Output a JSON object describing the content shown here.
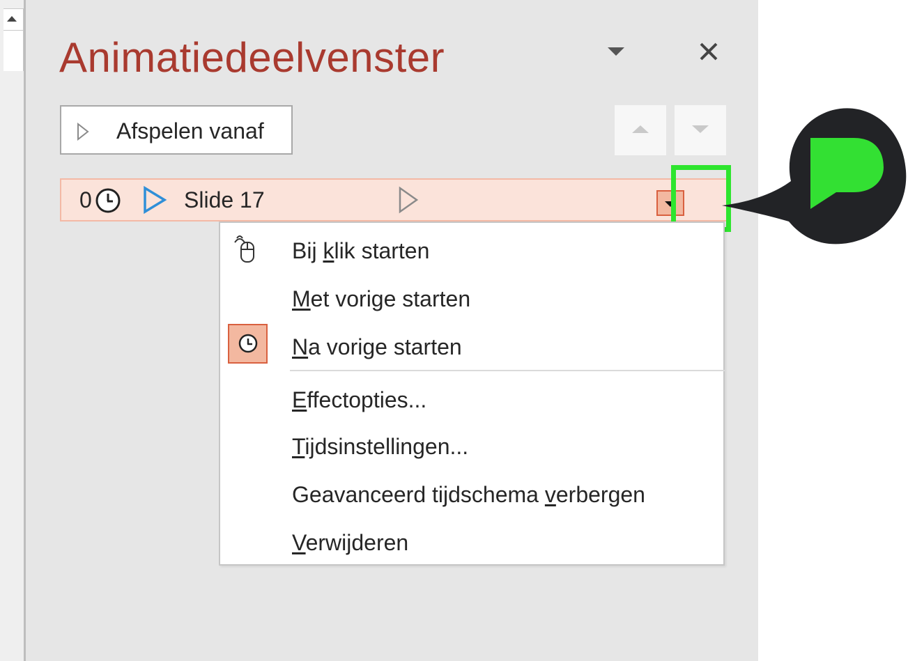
{
  "pane": {
    "title": "Animatiedeelvenster",
    "menu_icon": "dropdown-triangle-icon",
    "close_icon": "close-icon"
  },
  "toolbar": {
    "play_label": "Afspelen vanaf",
    "play_icon": "play-triangle-icon",
    "move_up_icon": "move-up-icon",
    "move_down_icon": "move-down-icon"
  },
  "animation_item": {
    "order": "0",
    "trigger_icon": "clock-icon",
    "effect_icon": "blue-play-icon",
    "name": "Slide 17",
    "timeline_icon": "outline-play-icon",
    "dropdown_icon": "dropdown-arrow-icon"
  },
  "context_menu": {
    "items": [
      {
        "pre": "Bij ",
        "key": "k",
        "post": "lik starten",
        "icon": "mouse-click-icon",
        "checked": false
      },
      {
        "pre": "",
        "key": "M",
        "post": "et vorige starten",
        "icon": "",
        "checked": false
      },
      {
        "pre": "",
        "key": "N",
        "post": "a vorige starten",
        "icon": "clock-icon",
        "checked": true
      },
      {
        "pre": "",
        "key": "E",
        "post": "ffectopties...",
        "icon": "",
        "checked": false
      },
      {
        "pre": "",
        "key": "T",
        "post": "ijdsinstellingen...",
        "icon": "",
        "checked": false
      },
      {
        "pre": "Geavanceerd tijdschema ",
        "key": "v",
        "post": "erbergen",
        "icon": "",
        "checked": false
      },
      {
        "pre": "",
        "key": "V",
        "post": "erwijderen",
        "icon": "",
        "checked": false
      }
    ]
  },
  "colors": {
    "title": "#a93a2f",
    "highlight": "#2ee52e",
    "callout_bubble": "#222326",
    "callout_logo": "#33e033",
    "selected_row": "#fbe3da",
    "accent_blue": "#2f8fd8"
  },
  "callout": {
    "icon": "brand-logo-icon"
  }
}
